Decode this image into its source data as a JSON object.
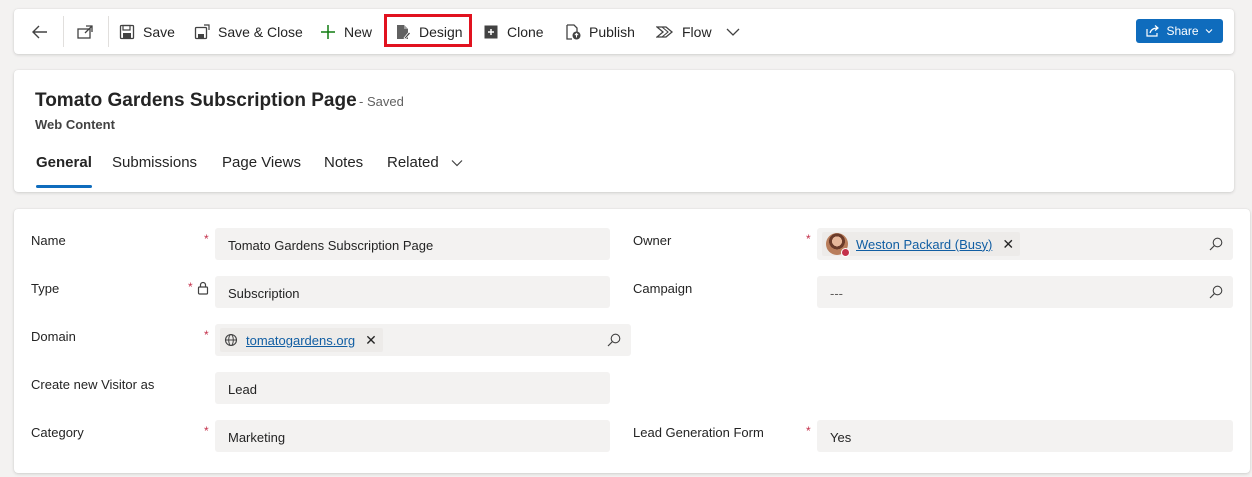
{
  "toolbar": {
    "save": "Save",
    "save_close": "Save & Close",
    "new": "New",
    "design": "Design",
    "clone": "Clone",
    "publish": "Publish",
    "flow": "Flow",
    "share": "Share"
  },
  "header": {
    "title": "Tomato Gardens Subscription Page",
    "status": "- Saved",
    "entity": "Web Content",
    "tabs": [
      "General",
      "Submissions",
      "Page Views",
      "Notes",
      "Related"
    ],
    "active_tab": "General"
  },
  "form": {
    "name": {
      "label": "Name",
      "value": "Tomato Gardens Subscription Page"
    },
    "type": {
      "label": "Type",
      "value": "Subscription"
    },
    "domain": {
      "label": "Domain",
      "value": "tomatogardens.org"
    },
    "visitor": {
      "label": "Create new Visitor as",
      "value": "Lead"
    },
    "category": {
      "label": "Category",
      "value": "Marketing"
    },
    "owner": {
      "label": "Owner",
      "value": "Weston Packard (Busy)"
    },
    "campaign": {
      "label": "Campaign",
      "placeholder": "---"
    },
    "leadgen": {
      "label": "Lead Generation Form",
      "value": "Yes"
    },
    "required_mark": "*"
  },
  "colors": {
    "accent": "#0f6cbd",
    "highlight": "#e1121f",
    "required": "#c4314b",
    "field_bg": "#f3f2f1"
  }
}
